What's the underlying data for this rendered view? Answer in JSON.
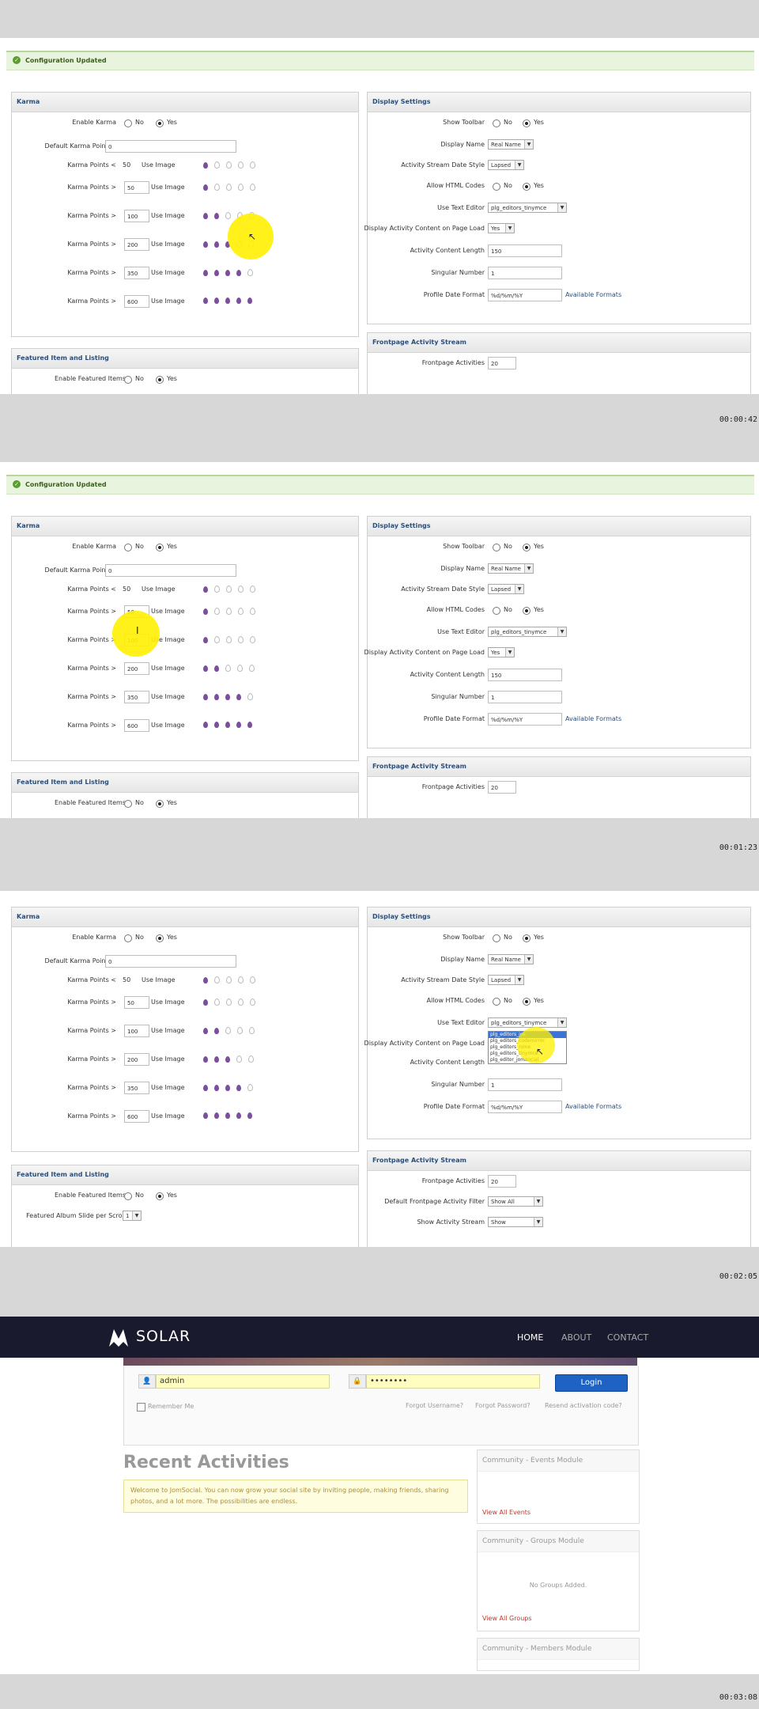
{
  "notice": "Configuration Updated",
  "karma": {
    "title": "Karma",
    "enable_label": "Enable Karma",
    "no": "No",
    "yes": "Yes",
    "default_label": "Default Karma Point(s)",
    "default_value": "0",
    "points_lt": "Karma Points <",
    "points_gt": "Karma Points >",
    "use_image": "Use Image",
    "first_value": "50",
    "levels": [
      "50",
      "100",
      "200",
      "350",
      "600"
    ],
    "filled": [
      1,
      1,
      2,
      3,
      4,
      5
    ]
  },
  "featured": {
    "title": "Featured Item and Listing",
    "enable_label": "Enable Featured Items",
    "slide_label": "Featured Album Slide per Scroll",
    "slide_value": "1"
  },
  "display": {
    "title": "Display Settings",
    "show_toolbar": "Show Toolbar",
    "display_name": "Display Name",
    "display_name_value": "Real Name",
    "date_style": "Activity Stream Date Style",
    "date_style_value": "Lapsed",
    "allow_html": "Allow HTML Codes",
    "text_editor": "Use Text Editor",
    "text_editor_value": "plg_editors_tinymce",
    "display_content": "Display Activity Content on Page Load",
    "display_content_value": "Yes",
    "content_length": "Activity Content Length",
    "content_length_value": "150",
    "singular": "Singular Number",
    "singular_value": "1",
    "date_format": "Profile Date Format",
    "date_format_value": "%d/%m/%Y",
    "formats_link": "Available Formats",
    "editor_options": [
      "plg_editors_jce",
      "plg_editors_codemirror",
      "plg_editors_none",
      "plg_editors_tinymce",
      "plg_editor_jomsocial"
    ]
  },
  "frontpage": {
    "title": "Frontpage Activity Stream",
    "activities": "Frontpage Activities",
    "activities_value": "20",
    "filter": "Default Frontpage Activity Filter",
    "filter_value": "Show All",
    "show_stream": "Show Activity Stream",
    "show_stream_value": "Show"
  },
  "timestamps": [
    "00:00:42",
    "00:01:23",
    "00:02:05",
    "00:03:08"
  ],
  "solar": {
    "brand": "SOLAR",
    "nav": [
      "HOME",
      "ABOUT",
      "CONTACT"
    ],
    "username": "admin",
    "password": "••••••••",
    "login": "Login",
    "remember": "Remember Me",
    "forgot_user": "Forgot Username?",
    "forgot_pass": "Forgot Password?",
    "resend": "Resend activation code?",
    "recent_title": "Recent Activities",
    "welcome": "Welcome to JomSocial. You can now grow your social site by inviting people, making friends, sharing photos, and a lot more. The possibilities are endless.",
    "events_title": "Community - Events Module",
    "events_link": "View All Events",
    "groups_title": "Community - Groups Module",
    "groups_empty": "No Groups Added.",
    "groups_link": "View All Groups",
    "members_title": "Community - Members Module"
  }
}
